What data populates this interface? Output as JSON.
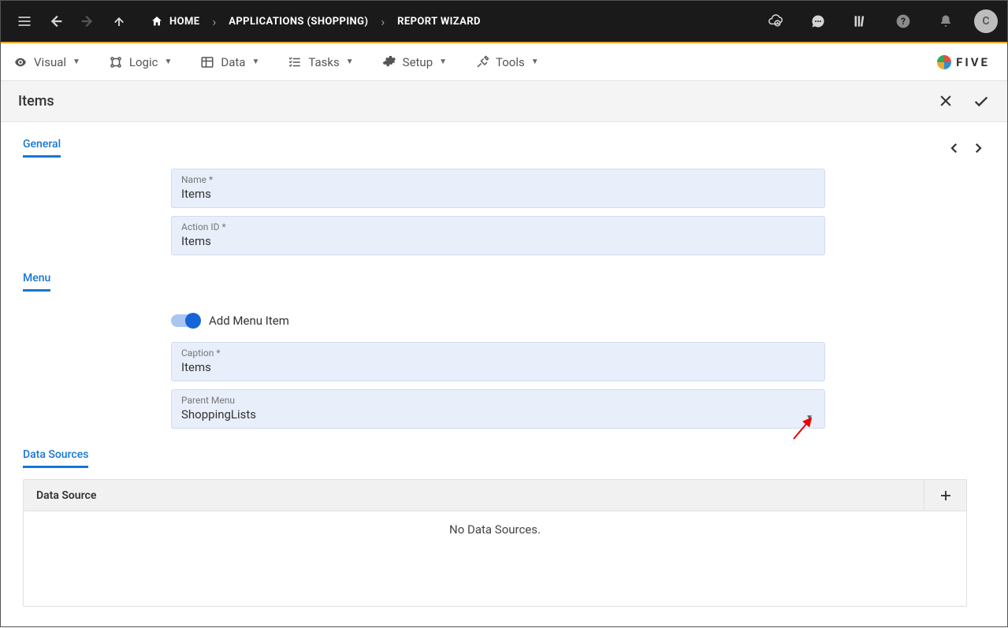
{
  "appbar": {
    "breadcrumbs": [
      {
        "label": "HOME"
      },
      {
        "label": "APPLICATIONS (SHOPPING)"
      },
      {
        "label": "REPORT WIZARD"
      }
    ],
    "avatar_initial": "C"
  },
  "menubar": {
    "items": [
      {
        "label": "Visual"
      },
      {
        "label": "Logic"
      },
      {
        "label": "Data"
      },
      {
        "label": "Tasks"
      },
      {
        "label": "Setup"
      },
      {
        "label": "Tools"
      }
    ],
    "logo_text": "FIVE"
  },
  "subheader": {
    "title": "Items"
  },
  "sections": {
    "general": {
      "label": "General",
      "fields": {
        "name": {
          "label": "Name *",
          "value": "Items"
        },
        "action_id": {
          "label": "Action ID *",
          "value": "Items"
        }
      }
    },
    "menu": {
      "label": "Menu",
      "toggle_label": "Add Menu Item",
      "toggle_on": true,
      "fields": {
        "caption": {
          "label": "Caption *",
          "value": "Items"
        },
        "parent_menu": {
          "label": "Parent Menu",
          "value": "ShoppingLists"
        }
      }
    },
    "data_sources": {
      "label": "Data Sources",
      "column_header": "Data Source",
      "empty_text": "No Data Sources."
    }
  }
}
